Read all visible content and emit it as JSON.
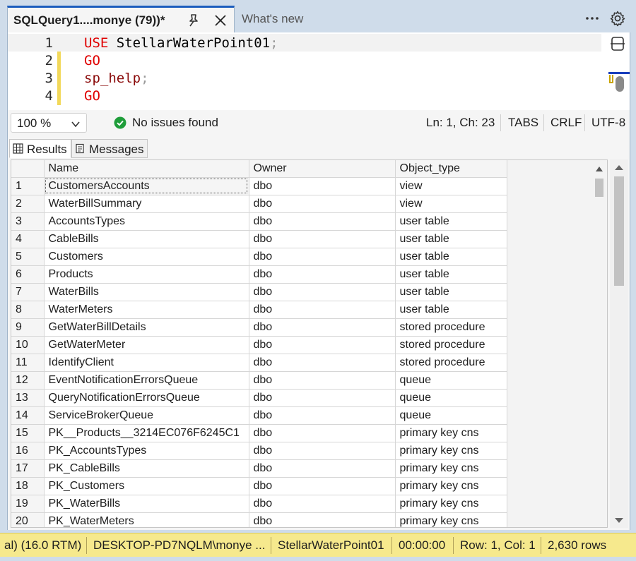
{
  "tabs": {
    "active_title": "SQLQuery1....monye (79))*",
    "inactive_title": "What's new"
  },
  "editor": {
    "lines": [
      {
        "num": "1",
        "kw": "USE",
        "rest": " StellarWaterPoint01",
        "semi": ";"
      },
      {
        "num": "2",
        "kw": "GO",
        "rest": "",
        "semi": ""
      },
      {
        "num": "3",
        "proc": "sp_help",
        "semi": ";"
      },
      {
        "num": "4",
        "kw": "GO",
        "rest": "",
        "semi": ""
      }
    ]
  },
  "editor_status": {
    "zoom": "100 %",
    "issues": "No issues found",
    "position": "Ln: 1, Ch: 23",
    "indent": "TABS",
    "eol": "CRLF",
    "encoding": "UTF-8"
  },
  "results_tabs": {
    "results": "Results",
    "messages": "Messages"
  },
  "grid": {
    "columns": [
      "Name",
      "Owner",
      "Object_type"
    ],
    "rows": [
      {
        "n": "1",
        "name": "CustomersAccounts",
        "owner": "dbo",
        "type": "view"
      },
      {
        "n": "2",
        "name": "WaterBillSummary",
        "owner": "dbo",
        "type": "view"
      },
      {
        "n": "3",
        "name": "AccountsTypes",
        "owner": "dbo",
        "type": "user table"
      },
      {
        "n": "4",
        "name": "CableBills",
        "owner": "dbo",
        "type": "user table"
      },
      {
        "n": "5",
        "name": "Customers",
        "owner": "dbo",
        "type": "user table"
      },
      {
        "n": "6",
        "name": "Products",
        "owner": "dbo",
        "type": "user table"
      },
      {
        "n": "7",
        "name": "WaterBills",
        "owner": "dbo",
        "type": "user table"
      },
      {
        "n": "8",
        "name": "WaterMeters",
        "owner": "dbo",
        "type": "user table"
      },
      {
        "n": "9",
        "name": "GetWaterBillDetails",
        "owner": "dbo",
        "type": "stored procedure"
      },
      {
        "n": "10",
        "name": "GetWaterMeter",
        "owner": "dbo",
        "type": "stored procedure"
      },
      {
        "n": "11",
        "name": "IdentifyClient",
        "owner": "dbo",
        "type": "stored procedure"
      },
      {
        "n": "12",
        "name": "EventNotificationErrorsQueue",
        "owner": "dbo",
        "type": "queue"
      },
      {
        "n": "13",
        "name": "QueryNotificationErrorsQueue",
        "owner": "dbo",
        "type": "queue"
      },
      {
        "n": "14",
        "name": "ServiceBrokerQueue",
        "owner": "dbo",
        "type": "queue"
      },
      {
        "n": "15",
        "name": "PK__Products__3214EC076F6245C1",
        "owner": "dbo",
        "type": "primary key cns"
      },
      {
        "n": "16",
        "name": "PK_AccountsTypes",
        "owner": "dbo",
        "type": "primary key cns"
      },
      {
        "n": "17",
        "name": "PK_CableBills",
        "owner": "dbo",
        "type": "primary key cns"
      },
      {
        "n": "18",
        "name": "PK_Customers",
        "owner": "dbo",
        "type": "primary key cns"
      },
      {
        "n": "19",
        "name": "PK_WaterBills",
        "owner": "dbo",
        "type": "primary key cns"
      },
      {
        "n": "20",
        "name": "PK_WaterMeters",
        "owner": "dbo",
        "type": "primary key cns"
      }
    ]
  },
  "statusbar": {
    "server_version": "al) (16.0 RTM)",
    "connection": "DESKTOP-PD7NQLM\\monye ...",
    "database": "StellarWaterPoint01",
    "elapsed": "00:00:00",
    "cursor": "Row: 1, Col: 1",
    "row_count": "2,630 rows"
  },
  "colors": {
    "accent": "#1b5dbd",
    "statusbar_bg": "#f6e98d",
    "keyword": "#e00000",
    "success": "#1f9d3a"
  },
  "icons": [
    "pin-icon",
    "close-icon",
    "more-options-icon",
    "settings-gear-icon",
    "split-editor-icon",
    "check-circle-icon",
    "chevron-down-icon",
    "grid-icon",
    "messages-icon",
    "scroll-up-icon",
    "scroll-down-icon"
  ]
}
